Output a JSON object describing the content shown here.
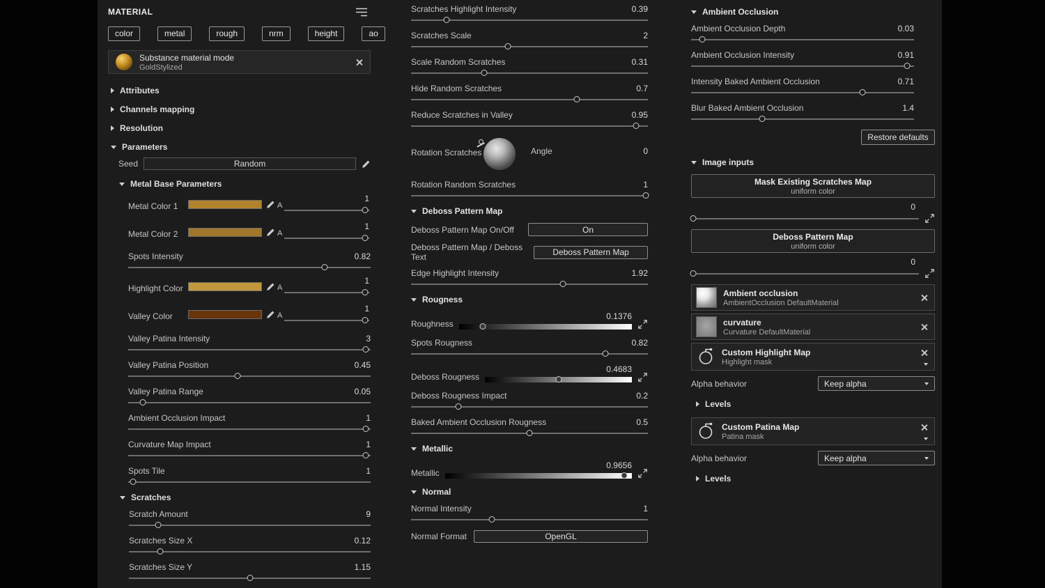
{
  "left": {
    "title": "MATERIAL",
    "channels": [
      "color",
      "metal",
      "rough",
      "nrm",
      "height",
      "ao"
    ],
    "material_card": {
      "title": "Substance material mode",
      "name": "GoldStylized"
    },
    "collapsed_sections": [
      "Attributes",
      "Channels mapping",
      "Resolution"
    ],
    "parameters_title": "Parameters",
    "seed": {
      "label": "Seed",
      "value": "Random"
    },
    "metal_base_title": "Metal Base Parameters",
    "color_params_a": [
      {
        "label": "Metal Color 1",
        "alpha": "A",
        "value": "1",
        "color": "#b2822c",
        "pct": 95
      },
      {
        "label": "Metal Color 2",
        "alpha": "A",
        "value": "1",
        "color": "#a2772b",
        "pct": 95
      }
    ],
    "spots_intensity": {
      "label": "Spots Intensity",
      "value": "0.82",
      "pct": 81
    },
    "color_params_b": [
      {
        "label": "Highlight Color",
        "alpha": "A",
        "value": "1",
        "color": "#c2983c",
        "pct": 95
      },
      {
        "label": "Valley Color",
        "alpha": "A",
        "value": "1",
        "color": "#693509",
        "pct": 95
      }
    ],
    "sliders": [
      {
        "label": "Valley Patina Intensity",
        "value": "3",
        "pct": 98
      },
      {
        "label": "Valley Patina Position",
        "value": "0.45",
        "pct": 45
      },
      {
        "label": "Valley Patina Range",
        "value": "0.05",
        "pct": 6
      },
      {
        "label": "Ambient Occlusion Impact",
        "value": "1",
        "pct": 98
      },
      {
        "label": "Curvature Map Impact",
        "value": "1",
        "pct": 98
      },
      {
        "label": "Spots Tile",
        "value": "1",
        "pct": 2
      }
    ],
    "scratches_title": "Scratches",
    "scratch_sliders": [
      {
        "label": "Scratch Amount",
        "value": "9",
        "pct": 12
      },
      {
        "label": "Scratches Size X",
        "value": "0.12",
        "pct": 13
      },
      {
        "label": "Scratches Size Y",
        "value": "1.15",
        "pct": 50
      }
    ]
  },
  "mid": {
    "sliders_top": [
      {
        "label": "Scratches Highlight Intensity",
        "value": "0.39",
        "pct": 15
      },
      {
        "label": "Scratches Scale",
        "value": "2",
        "pct": 41
      },
      {
        "label": "Scale Random Scratches",
        "value": "0.31",
        "pct": 31
      },
      {
        "label": "Hide Random Scratches",
        "value": "0.7",
        "pct": 70
      },
      {
        "label": "Reduce Scratches in Valley",
        "value": "0.95",
        "pct": 95
      }
    ],
    "rotation": {
      "label": "Rotation Scratches",
      "angle_label": "Angle",
      "angle_value": "0"
    },
    "rotation_random": {
      "label": "Rotation Random Scratches",
      "value": "1",
      "pct": 99
    },
    "deboss": {
      "title": "Deboss Pattern Map",
      "onoff_label": "Deboss Pattern Map On/Off",
      "onoff_value": "On",
      "mode_label": "Deboss Pattern Map / Deboss Text",
      "mode_value": "Deboss Pattern Map",
      "edge": {
        "label": "Edge Highlight Intensity",
        "value": "1.92",
        "pct": 64
      }
    },
    "rougness": {
      "title": "Rougness",
      "roughness": {
        "label": "Roughness",
        "value": "0.1376",
        "pct": 14
      },
      "spots": {
        "label": "Spots Rougness",
        "value": "0.82",
        "pct": 82
      },
      "deboss": {
        "label": "Deboss Rougness",
        "value": "0.4683",
        "pct": 50
      },
      "deboss_impact": {
        "label": "Deboss Rougness Impact",
        "value": "0.2",
        "pct": 20
      },
      "baked": {
        "label": "Baked Ambient Occlusion Rougness",
        "value": "0.5",
        "pct": 50
      }
    },
    "metallic_title": "Metallic",
    "metallic": {
      "label": "Metallic",
      "value": "0.9656",
      "pct": 96
    },
    "normal": {
      "title": "Normal",
      "intensity": {
        "label": "Normal Intensity",
        "value": "1",
        "pct": 34
      },
      "format_label": "Normal Format",
      "format_value": "OpenGL"
    }
  },
  "right": {
    "ao": {
      "title": "Ambient Occlusion",
      "sliders": [
        {
          "label": "Ambient Occlusion Depth",
          "value": "0.03",
          "pct": 5
        },
        {
          "label": "Ambient Occlusion Intensity",
          "value": "0.91",
          "pct": 97
        },
        {
          "label": "Intensity Baked Ambient Occlusion",
          "value": "0.71",
          "pct": 77
        },
        {
          "label": "Blur Baked Ambient Occlusion",
          "value": "1.4",
          "pct": 32
        }
      ],
      "restore_label": "Restore defaults"
    },
    "image_inputs": {
      "title": "Image inputs",
      "slots": [
        {
          "title": "Mask Existing Scratches Map",
          "subtitle": "uniform color",
          "value": "0",
          "pct": 1
        },
        {
          "title": "Deboss Pattern Map",
          "subtitle": "uniform color",
          "value": "0",
          "pct": 1
        }
      ],
      "cards": [
        {
          "title": "Ambient occlusion",
          "subtitle": "AmbientOcclusion DefaultMaterial",
          "thumb": "ao"
        },
        {
          "title": "curvature",
          "subtitle": "Curvature DefaultMaterial",
          "thumb": "curvature"
        }
      ],
      "mask_maps": [
        {
          "title": "Custom Highlight Map",
          "subtitle": "Highlight mask",
          "alpha_label": "Alpha behavior",
          "alpha_value": "Keep alpha",
          "levels_label": "Levels"
        },
        {
          "title": "Custom Patina Map",
          "subtitle": "Patina mask",
          "alpha_label": "Alpha behavior",
          "alpha_value": "Keep alpha",
          "levels_label": "Levels"
        }
      ]
    }
  }
}
